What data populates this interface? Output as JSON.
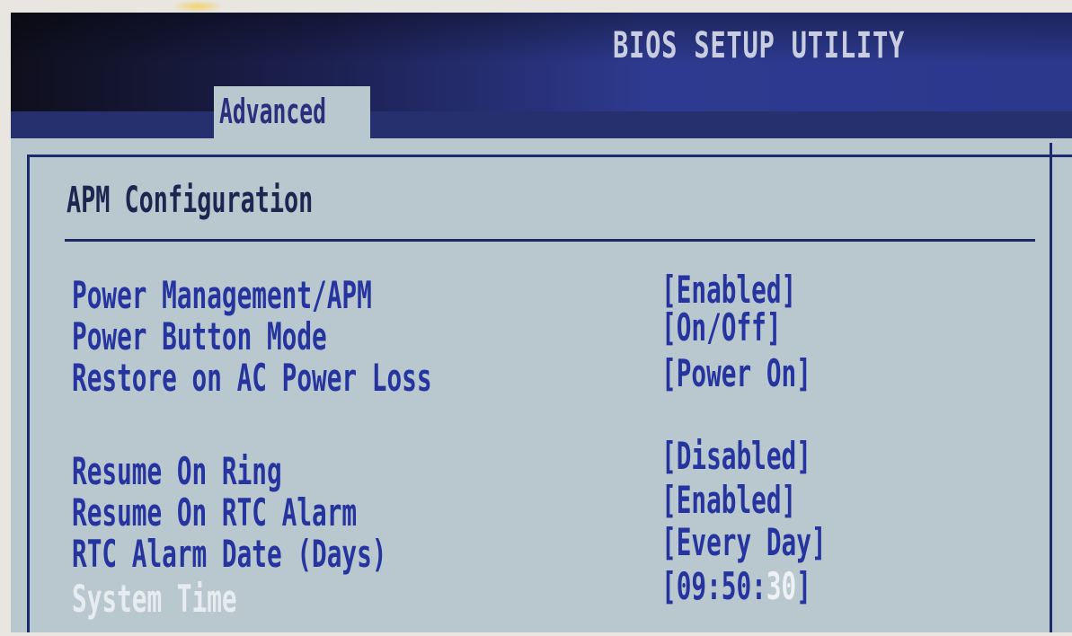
{
  "header": {
    "utility_title": "BIOS SETUP UTILITY",
    "active_tab": "Advanced"
  },
  "section": {
    "title": "APM Configuration"
  },
  "settings": [
    {
      "label": "Power Management/APM",
      "value": "[Enabled]"
    },
    {
      "label": "Power Button Mode",
      "value": "[On/Off]"
    },
    {
      "label": "Restore on AC Power Loss",
      "value": "[Power On]"
    },
    {
      "label": "Resume On Ring",
      "value": "[Disabled]"
    },
    {
      "label": "Resume On RTC Alarm",
      "value": "[Enabled]"
    },
    {
      "label": "RTC Alarm Date (Days)",
      "value": "[Every Day]"
    }
  ],
  "system_time": {
    "label": "System Time",
    "value_prefix": "[09:50:",
    "value_selected": "30",
    "value_suffix": "]"
  },
  "colors": {
    "header_blue": "#2e3a8f",
    "panel_gray": "#b9c7cf",
    "text_blue": "#2634a0",
    "highlight_white": "#eef2f5"
  }
}
